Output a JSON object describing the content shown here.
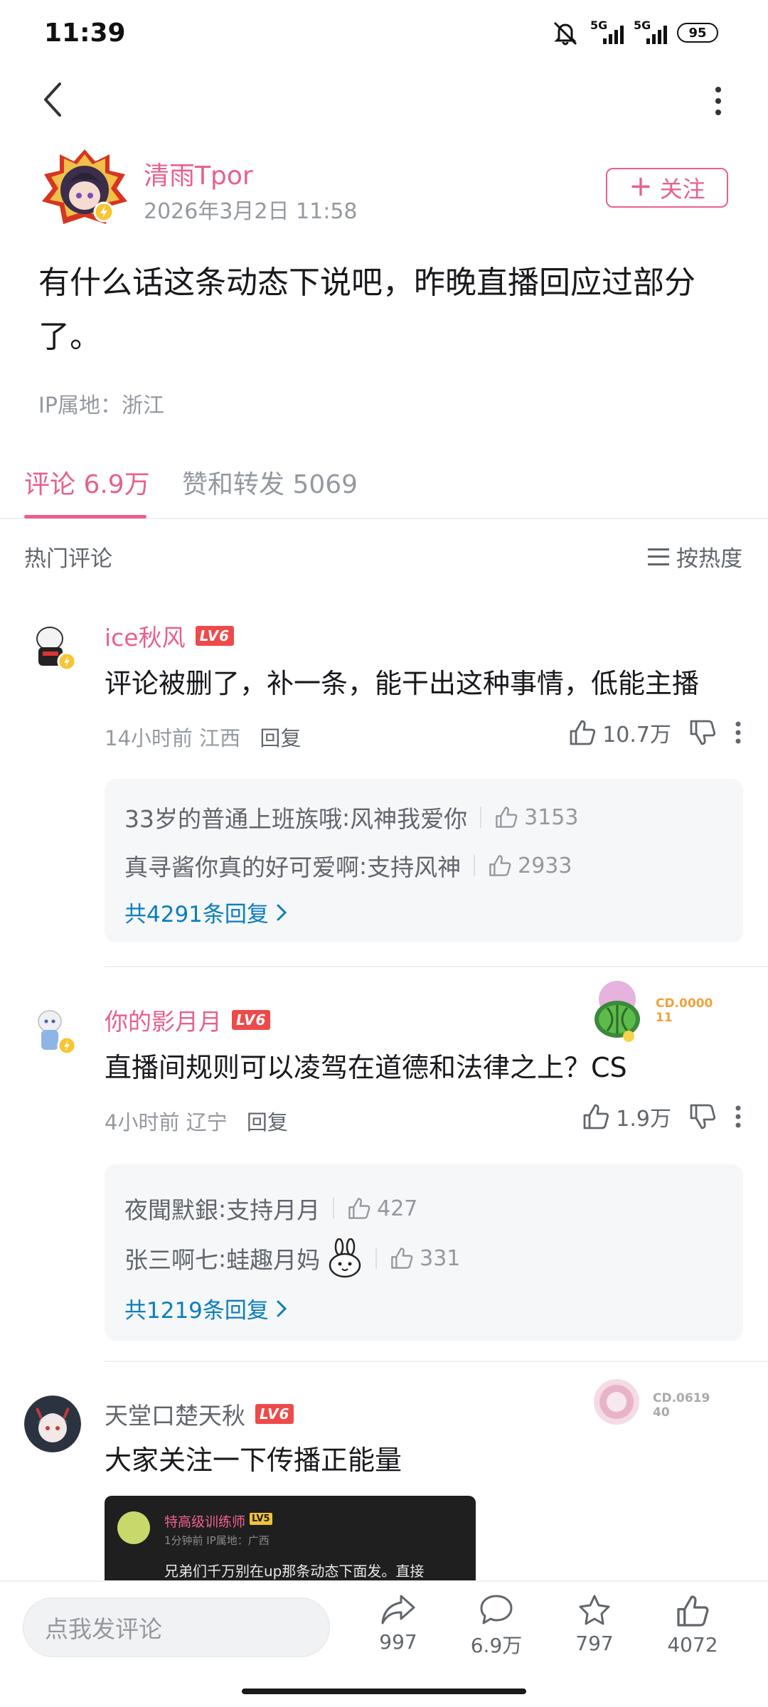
{
  "status_bar": {
    "time": "11:39",
    "net1": "5G",
    "net2": "5G",
    "battery": "95"
  },
  "author": {
    "name": "清雨Tpor",
    "date": "2026年3月2日 11:58",
    "follow_label": "关注"
  },
  "post": {
    "text": "有什么话这条动态下说吧，昨晚直播回应过部分了。",
    "ip": "IP属地：浙江"
  },
  "tabs": {
    "comments": "评论 6.9万",
    "likes_reposts": "赞和转发 5069"
  },
  "hot": {
    "title": "热门评论",
    "sort_label": "按热度"
  },
  "comments": [
    {
      "user": "ice秋风",
      "level": "LV6",
      "text": "评论被删了，补一条，能干出这种事情，低能主播",
      "time": "14小时前",
      "location": "江西",
      "reply_label": "回复",
      "likes": "10.7万",
      "replies": [
        {
          "user": "33岁的普通上班族哦",
          "text": "风神我爱你",
          "likes": "3153"
        },
        {
          "user": "真寻酱你真的好可爱啊",
          "text": "支持风神",
          "likes": "2933"
        }
      ],
      "more_label": "共4291条回复"
    },
    {
      "user": "你的影月月",
      "level": "LV6",
      "text": "直播间规则可以凌驾在道德和法律之上？CS",
      "time": "4小时前",
      "location": "辽宁",
      "reply_label": "回复",
      "likes": "1.9万",
      "badge_code": "CD.000011",
      "replies": [
        {
          "user": "夜聞默銀",
          "text": "支持月月",
          "likes": "427"
        },
        {
          "user": "张三啊七",
          "text": "蛙趣月妈",
          "likes": "331"
        }
      ],
      "more_label": "共1219条回复"
    },
    {
      "user": "天堂口楚天秋",
      "level": "LV6",
      "text": "大家关注一下传播正能量",
      "badge_code": "CD.061940",
      "image": {
        "name": "特高级训练师",
        "level": "LV5",
        "meta": "1分钟前 IP属地：广西",
        "text": "兄弟们千万别在up那条动态下面发。直接"
      }
    }
  ],
  "bottom_bar": {
    "input_placeholder": "点我发评论",
    "share_count": "997",
    "comment_count": "6.9万",
    "favorite_count": "797",
    "like_count": "4072"
  },
  "colors": {
    "accent": "#e8608c",
    "link": "#0a7ebd",
    "level_badge": "#ee4a4a"
  }
}
